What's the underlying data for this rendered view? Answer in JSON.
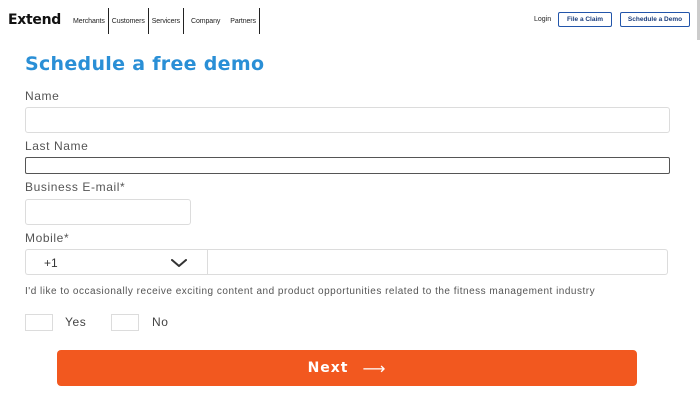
{
  "header": {
    "logo": "Extend",
    "nav": [
      "Merchants",
      "Customers",
      "Servicers",
      "Company",
      "Partners"
    ],
    "login": "Login",
    "file_claim": "File a Claim",
    "schedule_demo": "Schedule a Demo"
  },
  "form": {
    "title": "Schedule a free demo",
    "name_label": "Name",
    "name_value": "",
    "last_name_label": "Last Name",
    "last_name_value": "",
    "email_label": "Business E-mail*",
    "email_value": "",
    "mobile_label": "Mobile*",
    "country_code": "+1",
    "phone_value": "",
    "consent_text": "I'd like to occasionally receive exciting content and product opportunities related to the fitness management industry",
    "yes_label": "Yes",
    "no_label": "No",
    "next_label": "Next",
    "next_arrow": "⟶"
  },
  "colors": {
    "title": "#2a8fd6",
    "next_button": "#f2581f",
    "header_button_border": "#2255aa"
  }
}
